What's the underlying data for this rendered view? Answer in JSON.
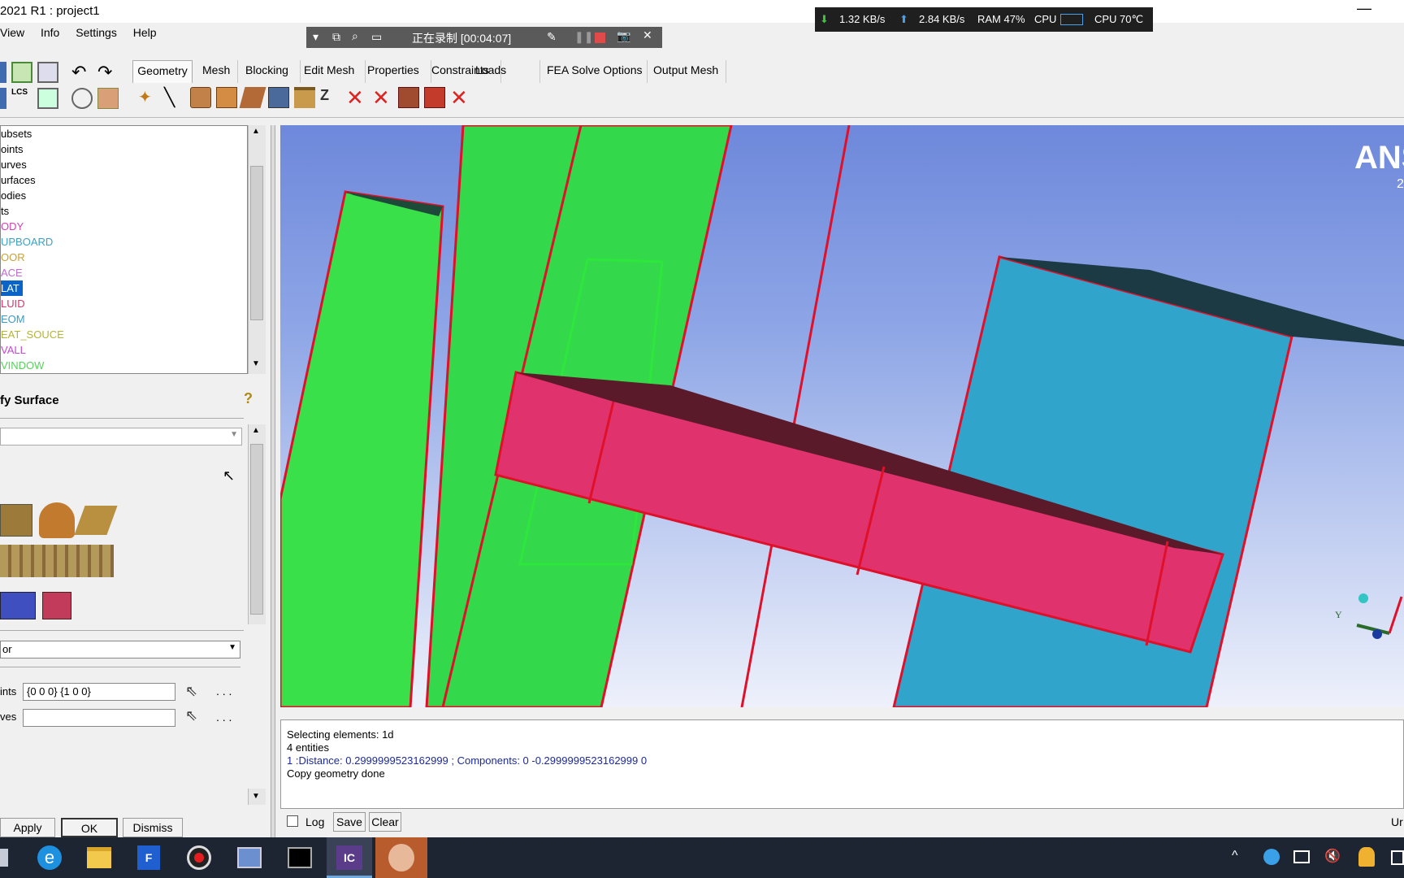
{
  "window": {
    "title": "2021 R1 : project1"
  },
  "menu": [
    "View",
    "Info",
    "Settings",
    "Help"
  ],
  "recorder": {
    "text": "正在录制 [00:04:07]"
  },
  "perf": {
    "down": "1.32 KB/s",
    "up": "2.84 KB/s",
    "ram": "RAM 47%",
    "cpu": "CPU",
    "cputemp": "CPU 70℃"
  },
  "tabs": [
    "Geometry",
    "Mesh",
    "Blocking",
    "Edit Mesh",
    "Properties",
    "Constraints",
    "Loads",
    "FEA Solve Options",
    "Output Mesh"
  ],
  "tree": {
    "items": [
      {
        "label": "ubsets",
        "color": "#000000"
      },
      {
        "label": "oints",
        "color": "#000000"
      },
      {
        "label": "urves",
        "color": "#000000"
      },
      {
        "label": "urfaces",
        "color": "#000000"
      },
      {
        "label": "odies",
        "color": "#000000"
      },
      {
        "label": "ts",
        "color": "#000000"
      },
      {
        "label": "ODY",
        "color": "#d23fb4"
      },
      {
        "label": "UPBOARD",
        "color": "#3aa2c4"
      },
      {
        "label": "OOR",
        "color": "#c6a23a"
      },
      {
        "label": "ACE",
        "color": "#c26ad4"
      },
      {
        "label": "LAT",
        "color": "#ffffff",
        "selected": true
      },
      {
        "label": "LUID",
        "color": "#d6356a"
      },
      {
        "label": "EOM",
        "color": "#3a9bc4"
      },
      {
        "label": "EAT_SOUCE",
        "color": "#b4b434"
      },
      {
        "label": "VALL",
        "color": "#c04ad0"
      },
      {
        "label": "VINDOW",
        "color": "#56d25a"
      }
    ]
  },
  "panel": {
    "title": "fy Surface",
    "method": "or",
    "points_label": "ints",
    "points_value": "{0 0 0} {1 0 0}",
    "curves_label": "ves",
    "curves_value": "",
    "dots": ". . .",
    "apply": "Apply",
    "ok": "OK",
    "dismiss": "Dismiss"
  },
  "viewport": {
    "logo": "ANS",
    "logo_sub": "2",
    "axis_y": "Y"
  },
  "log": {
    "lines": [
      {
        "text": "Selecting elements: 1d",
        "color": "#000000"
      },
      {
        "text": "4 entities",
        "color": "#000000"
      },
      {
        "text": "1 :Distance: 0.2999999523162999  ; Components:   0 -0.2999999523162999 0",
        "color": "#1c2a9a"
      },
      {
        "text": "Copy geometry done",
        "color": "#000000"
      }
    ],
    "log_label": "Log",
    "save": "Save",
    "clear": "Clear",
    "right_label": "Ur"
  },
  "taskbar": {
    "icons": [
      "ie-icon",
      "folder-icon",
      "f-app-icon",
      "record-icon",
      "remote-icon",
      "terminal-icon",
      "icem-icon",
      "avatar-icon"
    ],
    "ic_label": "IC",
    "f_label": "F"
  }
}
